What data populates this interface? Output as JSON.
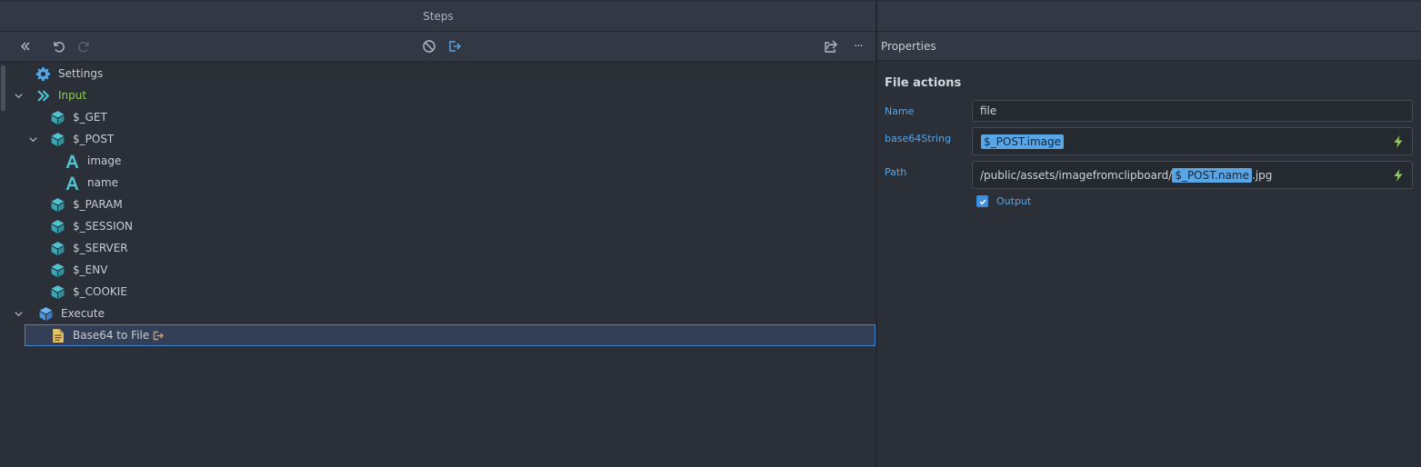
{
  "steps": {
    "header_title": "Steps",
    "toolbar": {
      "collapse_icon": "double-chevron-left-icon",
      "undo_icon": "undo-icon",
      "redo_icon": "redo-icon",
      "disable_icon": "block-icon",
      "export_icon": "export-icon",
      "share_icon": "share-icon",
      "more_label": "···"
    },
    "tree": {
      "settings": "Settings",
      "input": "Input",
      "get": "$_GET",
      "post": "$_POST",
      "post_image": "image",
      "post_name": "name",
      "param": "$_PARAM",
      "session": "$_SESSION",
      "server": "$_SERVER",
      "env": "$_ENV",
      "cookie": "$_COOKIE",
      "execute": "Execute",
      "base64_to_file": "Base64 to File"
    }
  },
  "properties": {
    "header_title": "Properties",
    "section_title": "File actions",
    "name_label": "Name",
    "name_value": "file",
    "base64_label": "base64String",
    "base64_chip": "$_POST.image",
    "path_label": "Path",
    "path_prefix": "/public/assets/imagefromclipboard/",
    "path_chip": "$_POST.name",
    "path_suffix": ".jpg",
    "output_label": "Output",
    "output_checked": true
  },
  "colors": {
    "accent": "#e8995a",
    "link_blue": "#58a6e6",
    "green": "#8dcb5a",
    "teal": "#4fc3d0",
    "file_yellow": "#e6c36a",
    "selection": "#3f86d1"
  }
}
